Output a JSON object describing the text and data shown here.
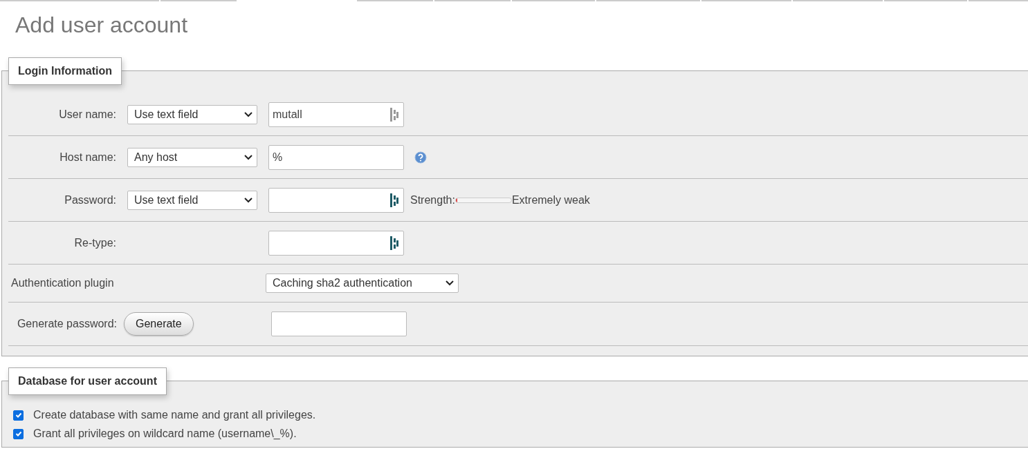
{
  "title": "Add user account",
  "login": {
    "legend": "Login Information",
    "rows": [
      {
        "kind": "field",
        "label": "User name:",
        "select": "Use text field",
        "value": "mutall",
        "key_active": false
      },
      {
        "kind": "help",
        "label": "Host name:",
        "select": "Any host",
        "value": "%"
      },
      {
        "kind": "password",
        "label": "Password:",
        "select": "Use text field",
        "value": "",
        "key_active": true,
        "strength_label": "Strength:",
        "level": 0,
        "strength": "Extremely weak"
      },
      {
        "kind": "field",
        "label": "Re-type:",
        "value": "",
        "key_active": true
      },
      {
        "kind": "plugin",
        "label": "Authentication plugin",
        "select": "Caching sha2 authentication"
      },
      {
        "kind": "generate",
        "label": "Generate password:",
        "button": "Generate",
        "value": ""
      }
    ]
  },
  "database": {
    "legend": "Database for user account",
    "options": [
      {
        "label": "Create database with same name and grant all privileges.",
        "checked": true
      },
      {
        "label": "Grant all privileges on wildcard name (username\\_%).",
        "checked": true
      }
    ]
  }
}
